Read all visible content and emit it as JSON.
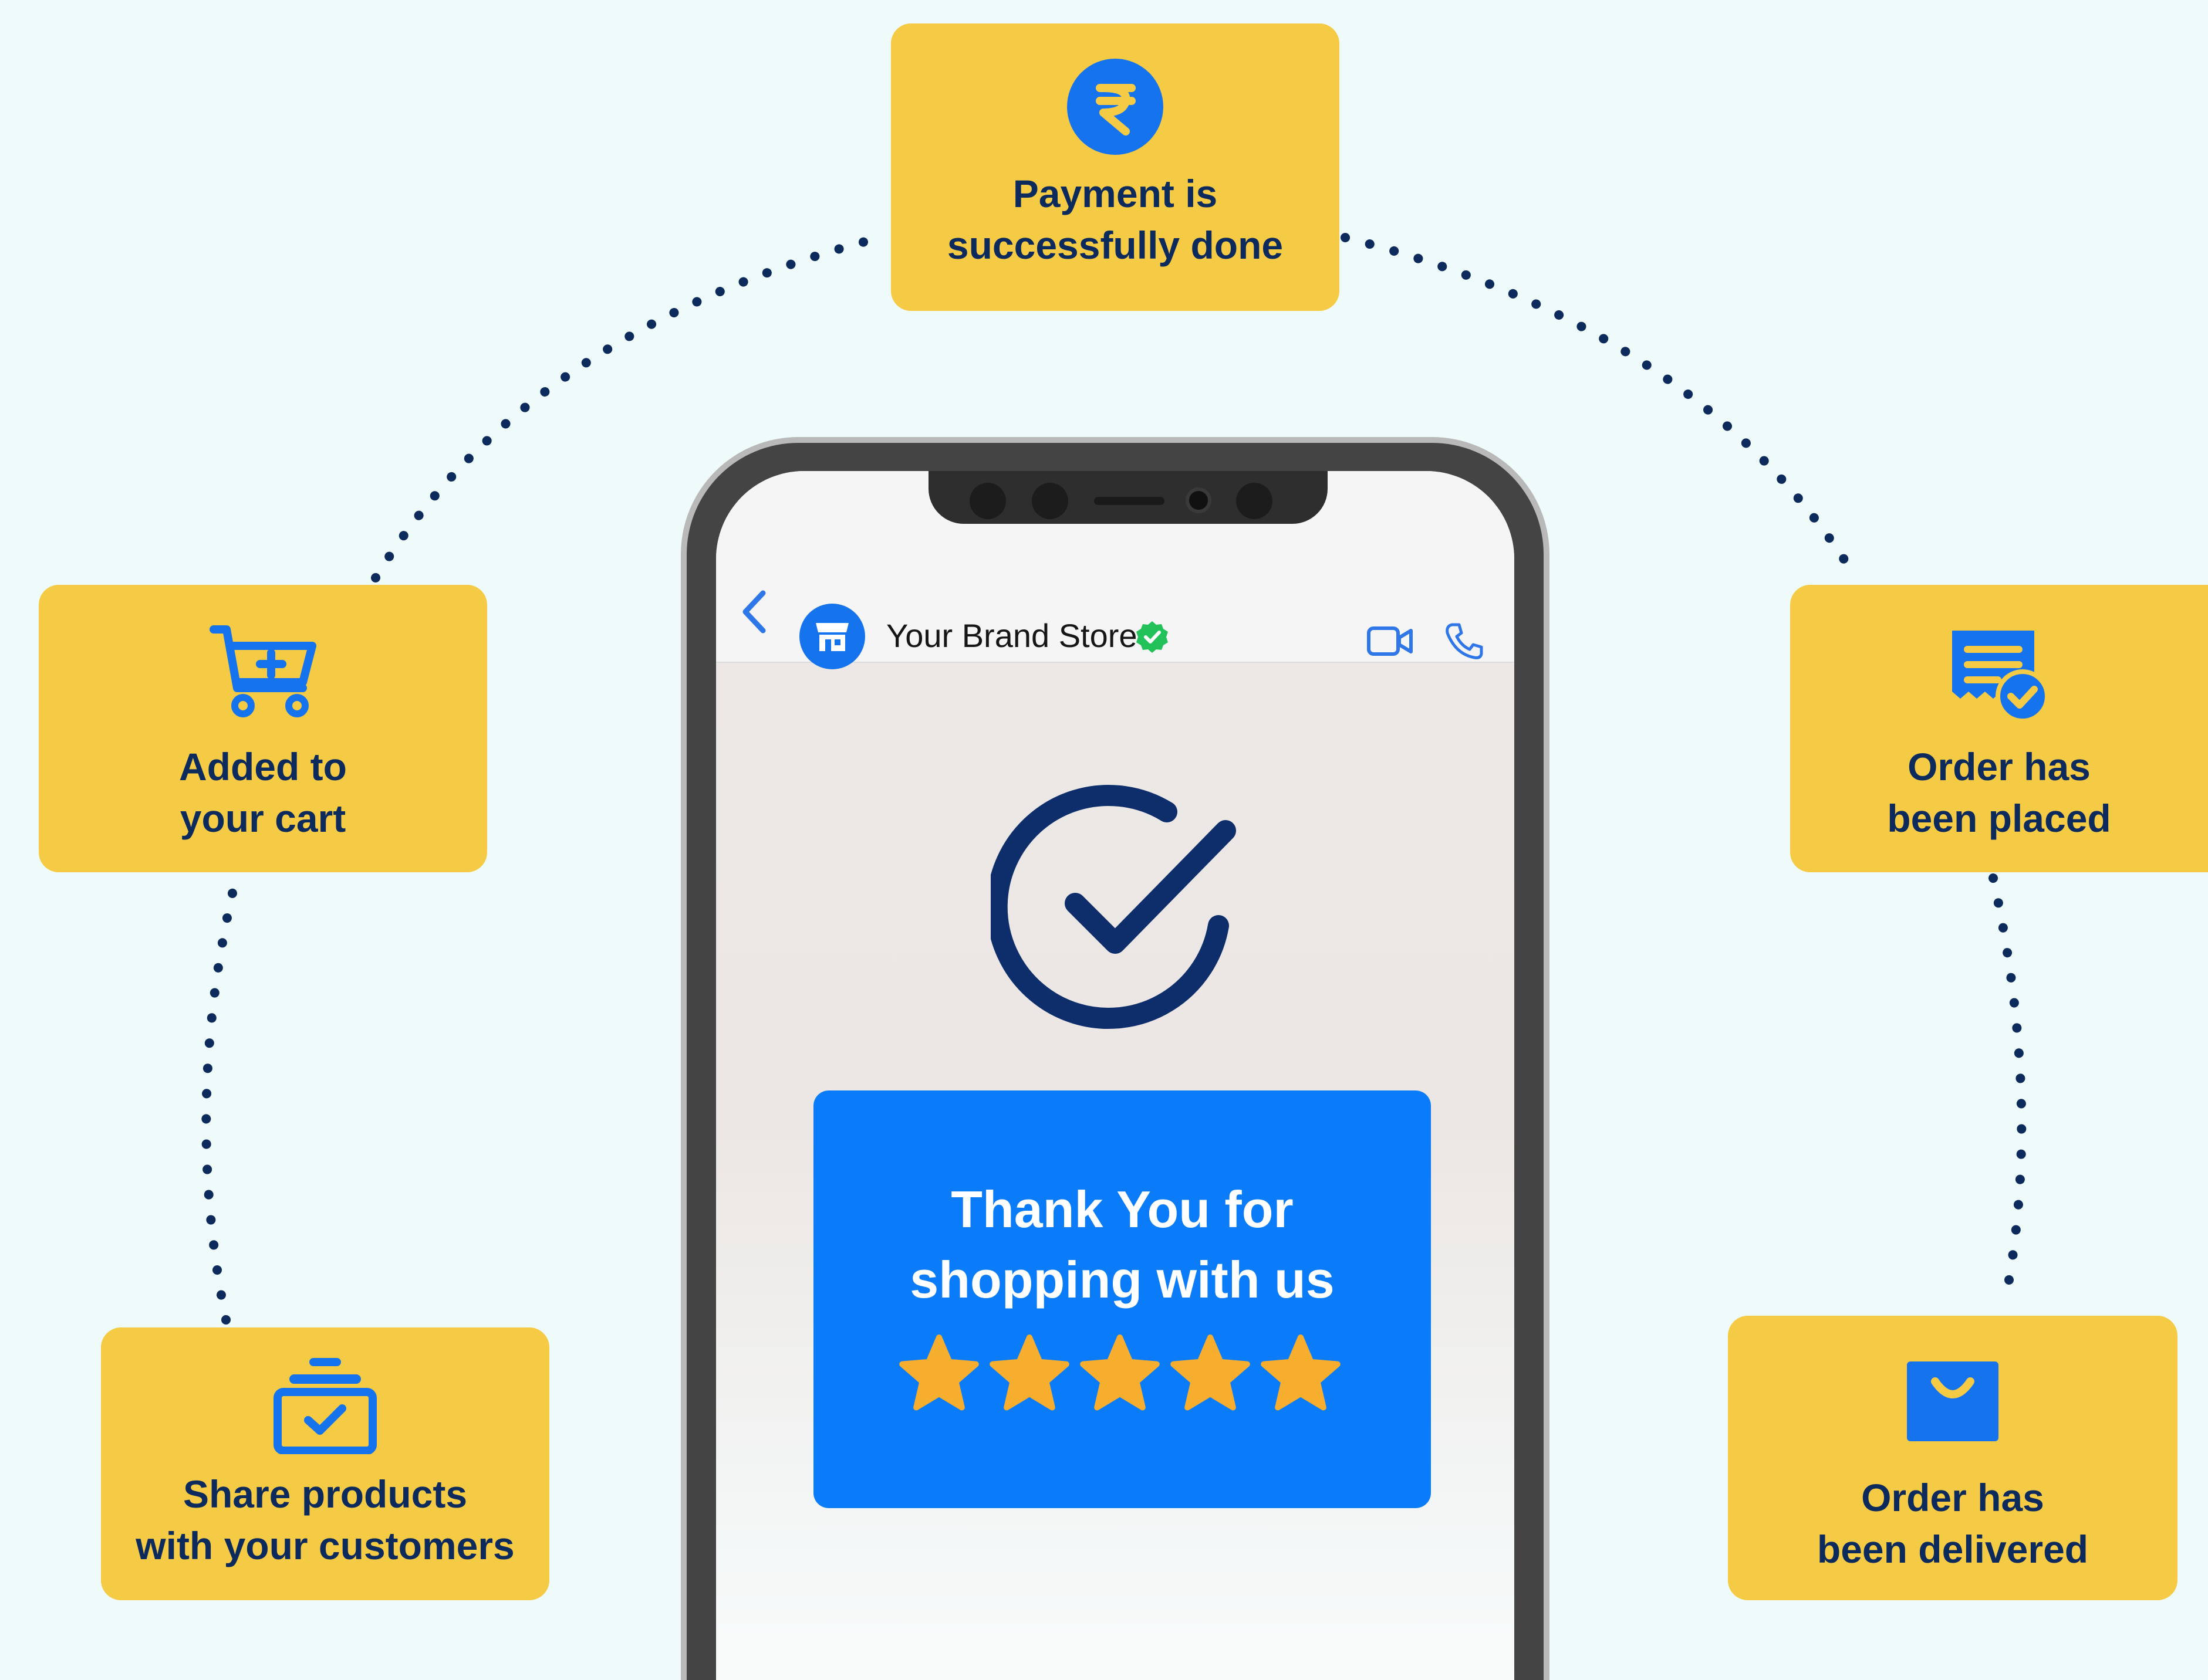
{
  "steps": {
    "payment": {
      "label_line1": "Payment is",
      "label_line2": "successfully done",
      "icon": "rupee-icon"
    },
    "cart": {
      "label_line1": "Added to",
      "label_line2": "your cart",
      "icon": "cart-add-icon"
    },
    "placed": {
      "label_line1": "Order has",
      "label_line2": "been placed",
      "icon": "receipt-check-icon"
    },
    "share": {
      "label_line1": "Share products",
      "label_line2": "with your customers",
      "icon": "box-check-icon"
    },
    "delivered": {
      "label_line1": "Order has",
      "label_line2": "been delivered",
      "icon": "shopping-bag-icon"
    }
  },
  "chat": {
    "store_name": "Your Brand Store",
    "back_icon": "chevron-left-icon",
    "avatar_icon": "storefront-icon",
    "verified_icon": "verified-badge-icon",
    "video_icon": "video-call-icon",
    "call_icon": "phone-call-icon"
  },
  "message": {
    "line1": "Thank You for",
    "line2": "shopping with us",
    "rating": 5,
    "rating_max": 5,
    "status_icon": "check-circle-icon"
  },
  "colors": {
    "background": "#eefbfa",
    "card": "#f5cb46",
    "text_dark": "#0d2a5c",
    "icon_blue": "#1673ee",
    "message_blue": "#0a7cf9",
    "star": "#f7ae2e",
    "dots": "#0d2a5c"
  }
}
